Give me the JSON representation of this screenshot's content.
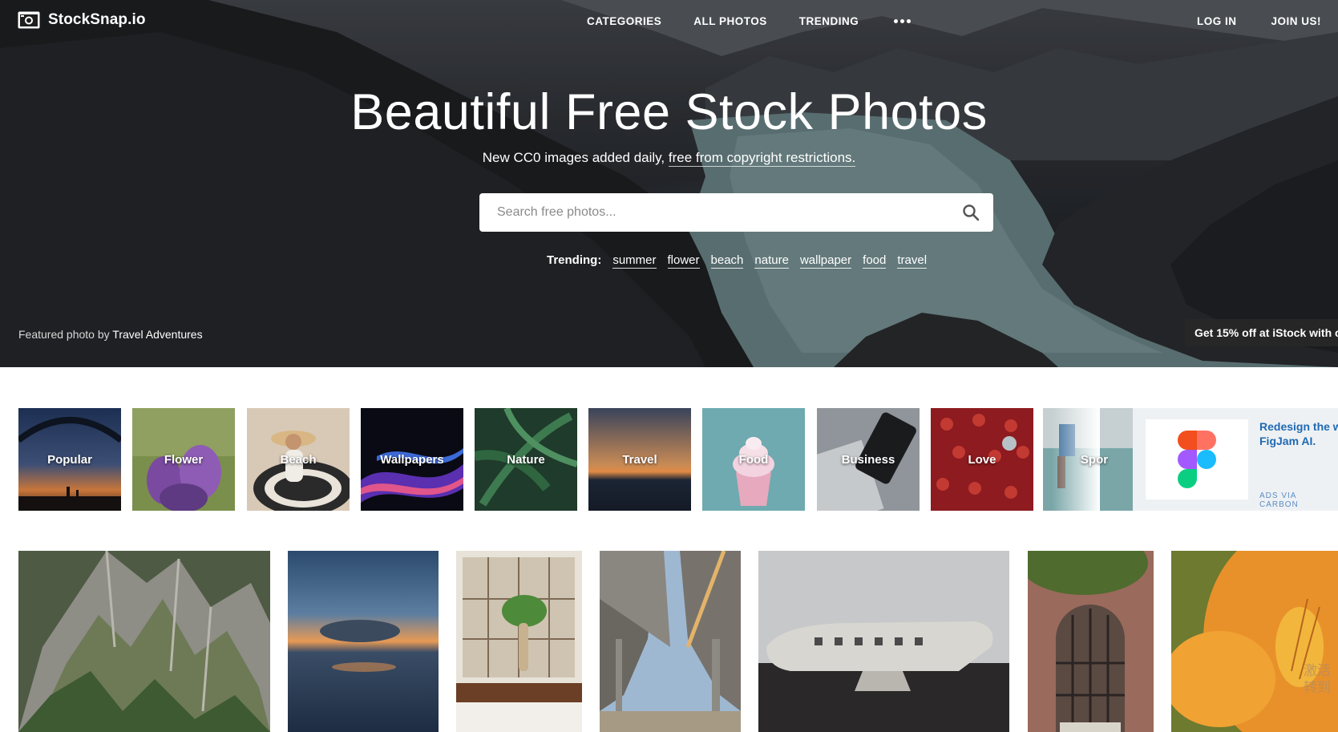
{
  "header": {
    "logo_text": "StockSnap.io",
    "nav": [
      "CATEGORIES",
      "ALL PHOTOS",
      "TRENDING"
    ],
    "more_icon": "more-dots-icon",
    "login": "LOG IN",
    "join": "JOIN US!"
  },
  "hero": {
    "title": "Beautiful Free Stock Photos",
    "subtitle_prefix": "New CC0 images added daily,",
    "subtitle_link": "free from copyright restrictions.",
    "search_placeholder": "Search free photos...",
    "search_icon": "search-icon",
    "trending_label": "Trending:",
    "trending_tags": [
      "summer",
      "flower",
      "beach",
      "nature",
      "wallpaper",
      "food",
      "travel"
    ],
    "featured_prefix": "Featured photo by",
    "featured_author": "Travel Adventures",
    "promo_text": "Get 15% off at iStock with co"
  },
  "categories": [
    "Popular",
    "Flower",
    "Beach",
    "Wallpapers",
    "Nature",
    "Travel",
    "Food",
    "Business",
    "Love",
    "Spor"
  ],
  "ad": {
    "text": "Redesign the w FigJam AI.",
    "via": "ADS VIA CARBON",
    "brand_colors": [
      "#f24e1e",
      "#ff7262",
      "#a259ff",
      "#1abcfe",
      "#0acf83"
    ]
  },
  "photos": [
    "mountain-ridge",
    "sunset-sea",
    "cafe-plant",
    "bridge-underside",
    "plane-wreck",
    "arched-window",
    "orange-lily"
  ],
  "watermark": [
    "激活",
    "转到"
  ]
}
